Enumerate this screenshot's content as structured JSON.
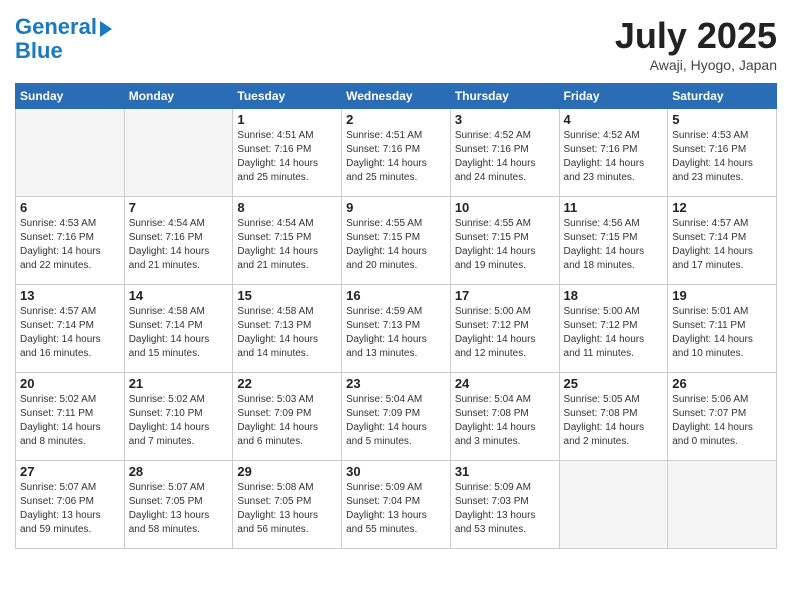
{
  "header": {
    "logo_line1": "General",
    "logo_line2": "Blue",
    "month": "July 2025",
    "location": "Awaji, Hyogo, Japan"
  },
  "weekdays": [
    "Sunday",
    "Monday",
    "Tuesday",
    "Wednesday",
    "Thursday",
    "Friday",
    "Saturday"
  ],
  "weeks": [
    [
      {
        "day": "",
        "info": ""
      },
      {
        "day": "",
        "info": ""
      },
      {
        "day": "1",
        "info": "Sunrise: 4:51 AM\nSunset: 7:16 PM\nDaylight: 14 hours\nand 25 minutes."
      },
      {
        "day": "2",
        "info": "Sunrise: 4:51 AM\nSunset: 7:16 PM\nDaylight: 14 hours\nand 25 minutes."
      },
      {
        "day": "3",
        "info": "Sunrise: 4:52 AM\nSunset: 7:16 PM\nDaylight: 14 hours\nand 24 minutes."
      },
      {
        "day": "4",
        "info": "Sunrise: 4:52 AM\nSunset: 7:16 PM\nDaylight: 14 hours\nand 23 minutes."
      },
      {
        "day": "5",
        "info": "Sunrise: 4:53 AM\nSunset: 7:16 PM\nDaylight: 14 hours\nand 23 minutes."
      }
    ],
    [
      {
        "day": "6",
        "info": "Sunrise: 4:53 AM\nSunset: 7:16 PM\nDaylight: 14 hours\nand 22 minutes."
      },
      {
        "day": "7",
        "info": "Sunrise: 4:54 AM\nSunset: 7:16 PM\nDaylight: 14 hours\nand 21 minutes."
      },
      {
        "day": "8",
        "info": "Sunrise: 4:54 AM\nSunset: 7:15 PM\nDaylight: 14 hours\nand 21 minutes."
      },
      {
        "day": "9",
        "info": "Sunrise: 4:55 AM\nSunset: 7:15 PM\nDaylight: 14 hours\nand 20 minutes."
      },
      {
        "day": "10",
        "info": "Sunrise: 4:55 AM\nSunset: 7:15 PM\nDaylight: 14 hours\nand 19 minutes."
      },
      {
        "day": "11",
        "info": "Sunrise: 4:56 AM\nSunset: 7:15 PM\nDaylight: 14 hours\nand 18 minutes."
      },
      {
        "day": "12",
        "info": "Sunrise: 4:57 AM\nSunset: 7:14 PM\nDaylight: 14 hours\nand 17 minutes."
      }
    ],
    [
      {
        "day": "13",
        "info": "Sunrise: 4:57 AM\nSunset: 7:14 PM\nDaylight: 14 hours\nand 16 minutes."
      },
      {
        "day": "14",
        "info": "Sunrise: 4:58 AM\nSunset: 7:14 PM\nDaylight: 14 hours\nand 15 minutes."
      },
      {
        "day": "15",
        "info": "Sunrise: 4:58 AM\nSunset: 7:13 PM\nDaylight: 14 hours\nand 14 minutes."
      },
      {
        "day": "16",
        "info": "Sunrise: 4:59 AM\nSunset: 7:13 PM\nDaylight: 14 hours\nand 13 minutes."
      },
      {
        "day": "17",
        "info": "Sunrise: 5:00 AM\nSunset: 7:12 PM\nDaylight: 14 hours\nand 12 minutes."
      },
      {
        "day": "18",
        "info": "Sunrise: 5:00 AM\nSunset: 7:12 PM\nDaylight: 14 hours\nand 11 minutes."
      },
      {
        "day": "19",
        "info": "Sunrise: 5:01 AM\nSunset: 7:11 PM\nDaylight: 14 hours\nand 10 minutes."
      }
    ],
    [
      {
        "day": "20",
        "info": "Sunrise: 5:02 AM\nSunset: 7:11 PM\nDaylight: 14 hours\nand 8 minutes."
      },
      {
        "day": "21",
        "info": "Sunrise: 5:02 AM\nSunset: 7:10 PM\nDaylight: 14 hours\nand 7 minutes."
      },
      {
        "day": "22",
        "info": "Sunrise: 5:03 AM\nSunset: 7:09 PM\nDaylight: 14 hours\nand 6 minutes."
      },
      {
        "day": "23",
        "info": "Sunrise: 5:04 AM\nSunset: 7:09 PM\nDaylight: 14 hours\nand 5 minutes."
      },
      {
        "day": "24",
        "info": "Sunrise: 5:04 AM\nSunset: 7:08 PM\nDaylight: 14 hours\nand 3 minutes."
      },
      {
        "day": "25",
        "info": "Sunrise: 5:05 AM\nSunset: 7:08 PM\nDaylight: 14 hours\nand 2 minutes."
      },
      {
        "day": "26",
        "info": "Sunrise: 5:06 AM\nSunset: 7:07 PM\nDaylight: 14 hours\nand 0 minutes."
      }
    ],
    [
      {
        "day": "27",
        "info": "Sunrise: 5:07 AM\nSunset: 7:06 PM\nDaylight: 13 hours\nand 59 minutes."
      },
      {
        "day": "28",
        "info": "Sunrise: 5:07 AM\nSunset: 7:05 PM\nDaylight: 13 hours\nand 58 minutes."
      },
      {
        "day": "29",
        "info": "Sunrise: 5:08 AM\nSunset: 7:05 PM\nDaylight: 13 hours\nand 56 minutes."
      },
      {
        "day": "30",
        "info": "Sunrise: 5:09 AM\nSunset: 7:04 PM\nDaylight: 13 hours\nand 55 minutes."
      },
      {
        "day": "31",
        "info": "Sunrise: 5:09 AM\nSunset: 7:03 PM\nDaylight: 13 hours\nand 53 minutes."
      },
      {
        "day": "",
        "info": ""
      },
      {
        "day": "",
        "info": ""
      }
    ]
  ]
}
